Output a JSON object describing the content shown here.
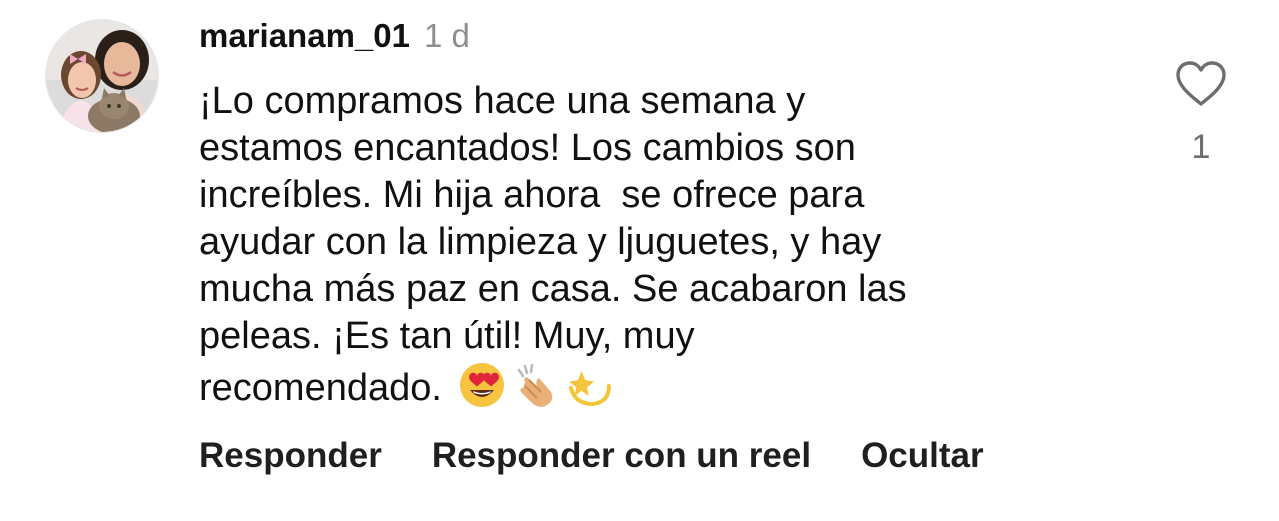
{
  "comment": {
    "username": "marianam_01",
    "time": "1 d",
    "body_lines": [
      "¡Lo compramos hace una semana y",
      "estamos encantados! Los cambios son",
      "increíbles. Mi hija ahora  se ofrece para",
      "ayudar con la limpieza y ljuguetes, y hay",
      "mucha más paz en casa. Se acabaron las",
      "peleas. ¡Es tan útil! Muy, muy",
      "recomendado."
    ],
    "emojis": [
      "heart-eyes",
      "clapping-hands",
      "dizzy-star"
    ],
    "like_count": "1",
    "actions": {
      "reply": "Responder",
      "reply_reel": "Responder con un reel",
      "hide": "Ocultar"
    },
    "colors": {
      "text": "#111111",
      "muted": "#8e8e8e",
      "icon": "#6d6d6d"
    }
  }
}
